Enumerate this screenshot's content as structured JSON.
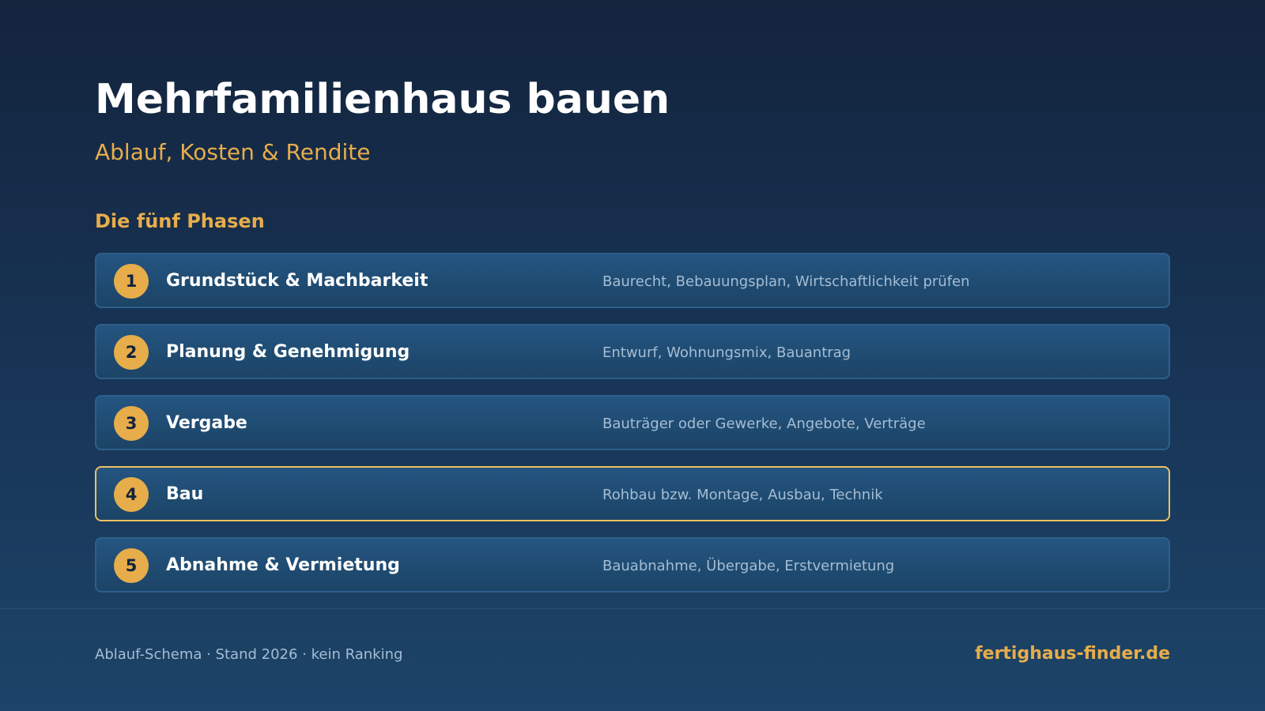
{
  "header": {
    "title": "Mehrfamilienhaus bauen",
    "subtitle": "Ablauf, Kosten & Rendite"
  },
  "section": {
    "heading": "Die fünf Phasen"
  },
  "phases": [
    {
      "number": "1",
      "title": "Grundstück & Machbarkeit",
      "description": "Baurecht, Bebauungsplan, Wirtschaftlichkeit prüfen",
      "highlighted": false
    },
    {
      "number": "2",
      "title": "Planung & Genehmigung",
      "description": "Entwurf, Wohnungsmix, Bauantrag",
      "highlighted": false
    },
    {
      "number": "3",
      "title": "Vergabe",
      "description": "Bauträger oder Gewerke, Angebote, Verträge",
      "highlighted": false
    },
    {
      "number": "4",
      "title": "Bau",
      "description": "Rohbau bzw. Montage, Ausbau, Technik",
      "highlighted": true
    },
    {
      "number": "5",
      "title": "Abnahme & Vermietung",
      "description": "Bauabnahme, Übergabe, Erstvermietung",
      "highlighted": false
    }
  ],
  "footer": {
    "note": "Ablauf-Schema · Stand 2026 · kein Ranking",
    "brand": "fertighaus-finder.de"
  },
  "colors": {
    "accent": "#e7ad4b",
    "highlight_border": "#ecc15f",
    "background_top": "#13243d",
    "background_bottom": "#1c4468"
  }
}
